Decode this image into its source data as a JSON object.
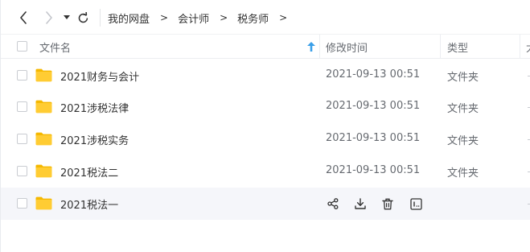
{
  "breadcrumb": [
    {
      "label": "我的网盘"
    },
    {
      "label": "会计师"
    },
    {
      "label": "税务师"
    }
  ],
  "breadcrumb_separator": ">",
  "columns": {
    "name": "文件名",
    "time": "修改时间",
    "type": "类型",
    "size": "大"
  },
  "sort": {
    "column": "name",
    "direction": "ascending"
  },
  "files": [
    {
      "name": "2021财务与会计",
      "time": "2021-09-13 00:51",
      "type": "文件夹"
    },
    {
      "name": "2021涉税法律",
      "time": "2021-09-13 00:51",
      "type": "文件夹"
    },
    {
      "name": "2021涉税实务",
      "time": "2021-09-13 00:51",
      "type": "文件夹"
    },
    {
      "name": "2021税法二",
      "time": "2021-09-13 00:51",
      "type": "文件夹"
    },
    {
      "name": "2021税法一",
      "time": "",
      "type": ""
    }
  ],
  "hovered_row_actions": [
    "share-icon",
    "download-icon",
    "delete-icon",
    "more-icon"
  ],
  "colors": {
    "folder": "#ffcc33",
    "folder_tab": "#f5b800",
    "sort_arrow": "#3a9fe8",
    "hover_row": "#f5f6fa",
    "text_primary": "#333333",
    "text_secondary": "#666a70"
  }
}
